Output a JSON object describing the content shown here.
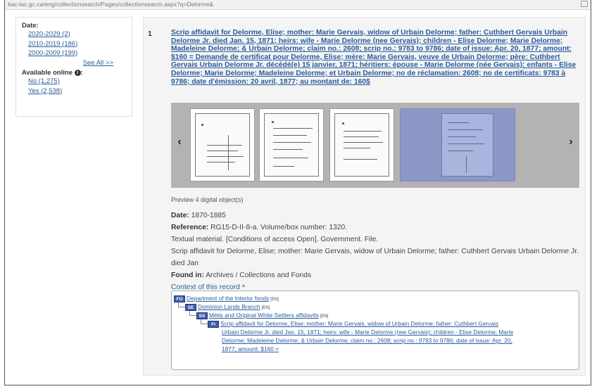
{
  "browser": {
    "url": "bac-lac.gc.ca/eng/collectionsearch/Pages/collectionsearch.aspx?q=Delorme&"
  },
  "sidebar": {
    "date_header": "Date:",
    "date_facets": [
      "2020-2029 (2)",
      "2010-2019 (186)",
      "2000-2009 (199)"
    ],
    "see_all": "See All >>",
    "online_header": "Available online",
    "online_facets": [
      "No (1,275)",
      "Yes (2,538)"
    ]
  },
  "result": {
    "number": "1",
    "title": "Scrip affidavit for Delorme, Elise; mother: Marie Gervais, widow of Urbain Delorme; father: Cuthbert Gervais Urbain Delorme Jr. died Jan. 15, 1871; heirs: wife - Marie Delorme (nee Gervais); children - Elise Delorme; Marie Delorme; Madeleine Delorme; & Urbain Delorme; claim no.: 2608; scrip no.: 9783 to 9786; date of issue: Apr. 20, 1877; amount: $160 = Demande de certificat pour Delorme, Elise; mère: Marie Gervais, veuve de Urbain Delorme; père: Cuthbert Gervais Urbain Delorme Jr. décédé(e) 15 janvier, 1871; héritiers: épouse - Marie Delorme (née Gervais); enfants - Elise Delorme; Marie Delorme; Madeleine Delorme; et Urbain Delorme; no de réclamation: 2608; no de certificats: 9783 à 9786; date d'émission: 20 avril, 1877; au montant de: 160$",
    "carousel_prev": "‹",
    "carousel_next": "›",
    "preview_text": "Preview 4 digital object(s)",
    "date_label": "Date:",
    "date_value": "1870-1885",
    "reference_label": "Reference:",
    "reference_value": "RG15-D-II-8-a. Volume/box number: 1320.",
    "description_1": "Textual material. [Conditions of access Open]. Government. File.",
    "description_2": "Scrip affidavit for Delorme, Elise; mother: Marie Gervais, widow of Urbain Delorme; father: Cuthbert Gervais Urbain Delorme Jr. died Jan",
    "found_in_label": "Found in:",
    "found_in_value": "Archives / Collections and Fonds",
    "context_label": "Context of this record",
    "context_caret": "^"
  },
  "hierarchy": [
    {
      "level": "FO",
      "title": "Department of the Interior fonds",
      "lang": "[EN]"
    },
    {
      "level": "SE",
      "title": "Dominion Lands Branch",
      "lang": "[EN]"
    },
    {
      "level": "SS",
      "title": "Métis and Original White Settlers affidavits",
      "lang": "[EN]"
    },
    {
      "level": "FI",
      "title_lines": [
        "Scrip affidavit for Delorme, Elise; mother: Marie Gervais, widow of Urbain Delorme; father: Cuthbert Gervais",
        "Urbain Delorme Jr. died Jan. 15, 1871; heirs: wife - Marie Delorme (nee Gervais); children - Elise Delorme; Marie",
        "Delorme; Madeleine Delorme; & Urbain Delorme; claim no.: 2608; scrip no.: 9783 to 9786; date of issue: Apr. 20,",
        "1877; amount: $160 ="
      ]
    }
  ],
  "colors": {
    "link": "#2a5b9c",
    "panel": "#f4f4f4",
    "carousel": "#b3b3b3",
    "level_badge": "#3d5ca8"
  }
}
